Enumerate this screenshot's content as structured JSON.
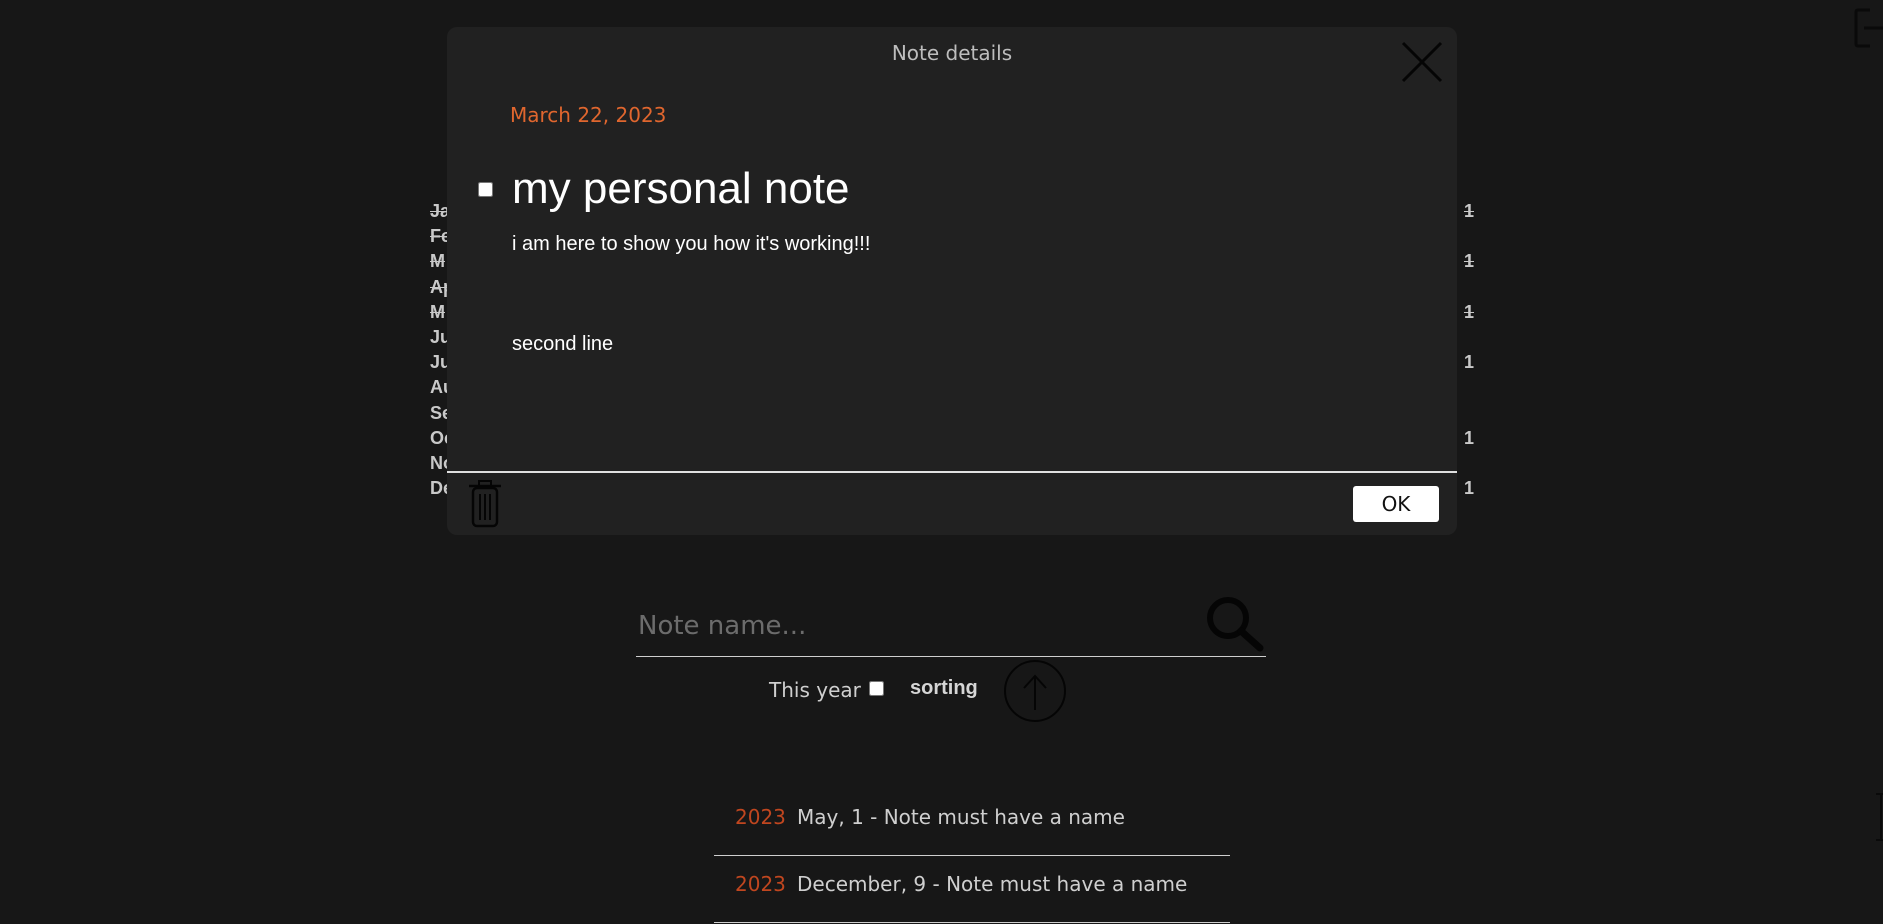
{
  "modal": {
    "title": "Note details",
    "date": "March 22, 2023",
    "note_title": "my personal note",
    "body_lines": [
      "i am here to show you how it's working!!!",
      "second line"
    ],
    "ok_label": "OK"
  },
  "months": [
    {
      "name": "Ja",
      "count": "1",
      "done": true
    },
    {
      "name": "Fe",
      "count": "",
      "done": true
    },
    {
      "name": "M",
      "count": "1",
      "done": true
    },
    {
      "name": "Ap",
      "count": "",
      "done": true
    },
    {
      "name": "M",
      "count": "1",
      "done": true
    },
    {
      "name": "Ju",
      "count": "",
      "done": false
    },
    {
      "name": "Ju",
      "count": "1",
      "done": false
    },
    {
      "name": "Au",
      "count": "",
      "done": false
    },
    {
      "name": "Se",
      "count": "",
      "done": false
    },
    {
      "name": "Oc",
      "count": "1",
      "done": false
    },
    {
      "name": "No",
      "count": "",
      "done": false
    },
    {
      "name": "De",
      "count": "1",
      "done": false
    }
  ],
  "search": {
    "placeholder": "Note name..."
  },
  "filters": {
    "this_year_label": "This year",
    "sorting_label": "sorting"
  },
  "notes": [
    {
      "year": "2023",
      "text": "May, 1 - Note must have a name"
    },
    {
      "year": "2023",
      "text": "December, 9 - Note must have a name"
    }
  ],
  "colors": {
    "background": "#171717",
    "modal": "#212121",
    "accent": "#e0662e",
    "year": "#c0461f"
  },
  "icons": [
    "exit-icon",
    "close-icon",
    "trash-icon",
    "search-icon",
    "arrow-up-icon"
  ]
}
